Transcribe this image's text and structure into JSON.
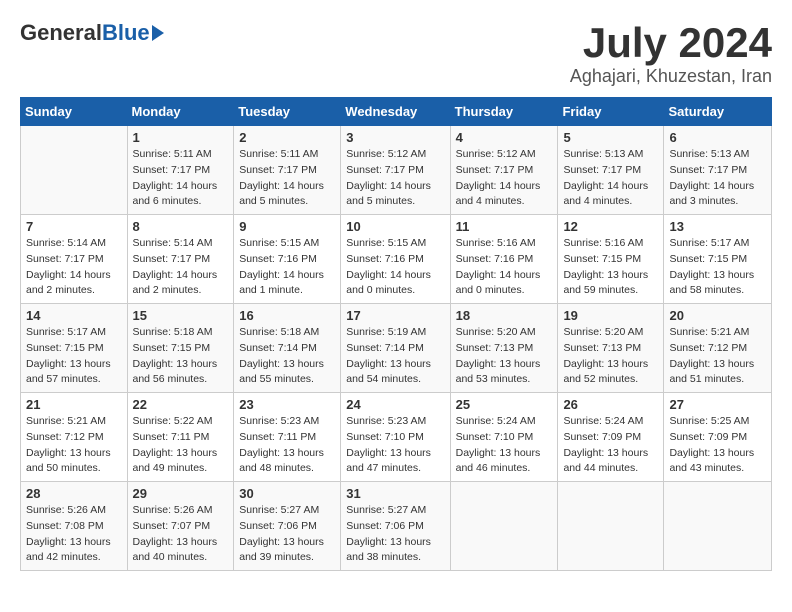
{
  "header": {
    "logo_general": "General",
    "logo_blue": "Blue",
    "month_title": "July 2024",
    "location": "Aghajari, Khuzestan, Iran"
  },
  "days_of_week": [
    "Sunday",
    "Monday",
    "Tuesday",
    "Wednesday",
    "Thursday",
    "Friday",
    "Saturday"
  ],
  "weeks": [
    [
      {
        "day": "",
        "sunrise": "",
        "sunset": "",
        "daylight": ""
      },
      {
        "day": "1",
        "sunrise": "Sunrise: 5:11 AM",
        "sunset": "Sunset: 7:17 PM",
        "daylight": "Daylight: 14 hours and 6 minutes."
      },
      {
        "day": "2",
        "sunrise": "Sunrise: 5:11 AM",
        "sunset": "Sunset: 7:17 PM",
        "daylight": "Daylight: 14 hours and 5 minutes."
      },
      {
        "day": "3",
        "sunrise": "Sunrise: 5:12 AM",
        "sunset": "Sunset: 7:17 PM",
        "daylight": "Daylight: 14 hours and 5 minutes."
      },
      {
        "day": "4",
        "sunrise": "Sunrise: 5:12 AM",
        "sunset": "Sunset: 7:17 PM",
        "daylight": "Daylight: 14 hours and 4 minutes."
      },
      {
        "day": "5",
        "sunrise": "Sunrise: 5:13 AM",
        "sunset": "Sunset: 7:17 PM",
        "daylight": "Daylight: 14 hours and 4 minutes."
      },
      {
        "day": "6",
        "sunrise": "Sunrise: 5:13 AM",
        "sunset": "Sunset: 7:17 PM",
        "daylight": "Daylight: 14 hours and 3 minutes."
      }
    ],
    [
      {
        "day": "7",
        "sunrise": "Sunrise: 5:14 AM",
        "sunset": "Sunset: 7:17 PM",
        "daylight": "Daylight: 14 hours and 2 minutes."
      },
      {
        "day": "8",
        "sunrise": "Sunrise: 5:14 AM",
        "sunset": "Sunset: 7:17 PM",
        "daylight": "Daylight: 14 hours and 2 minutes."
      },
      {
        "day": "9",
        "sunrise": "Sunrise: 5:15 AM",
        "sunset": "Sunset: 7:16 PM",
        "daylight": "Daylight: 14 hours and 1 minute."
      },
      {
        "day": "10",
        "sunrise": "Sunrise: 5:15 AM",
        "sunset": "Sunset: 7:16 PM",
        "daylight": "Daylight: 14 hours and 0 minutes."
      },
      {
        "day": "11",
        "sunrise": "Sunrise: 5:16 AM",
        "sunset": "Sunset: 7:16 PM",
        "daylight": "Daylight: 14 hours and 0 minutes."
      },
      {
        "day": "12",
        "sunrise": "Sunrise: 5:16 AM",
        "sunset": "Sunset: 7:15 PM",
        "daylight": "Daylight: 13 hours and 59 minutes."
      },
      {
        "day": "13",
        "sunrise": "Sunrise: 5:17 AM",
        "sunset": "Sunset: 7:15 PM",
        "daylight": "Daylight: 13 hours and 58 minutes."
      }
    ],
    [
      {
        "day": "14",
        "sunrise": "Sunrise: 5:17 AM",
        "sunset": "Sunset: 7:15 PM",
        "daylight": "Daylight: 13 hours and 57 minutes."
      },
      {
        "day": "15",
        "sunrise": "Sunrise: 5:18 AM",
        "sunset": "Sunset: 7:15 PM",
        "daylight": "Daylight: 13 hours and 56 minutes."
      },
      {
        "day": "16",
        "sunrise": "Sunrise: 5:18 AM",
        "sunset": "Sunset: 7:14 PM",
        "daylight": "Daylight: 13 hours and 55 minutes."
      },
      {
        "day": "17",
        "sunrise": "Sunrise: 5:19 AM",
        "sunset": "Sunset: 7:14 PM",
        "daylight": "Daylight: 13 hours and 54 minutes."
      },
      {
        "day": "18",
        "sunrise": "Sunrise: 5:20 AM",
        "sunset": "Sunset: 7:13 PM",
        "daylight": "Daylight: 13 hours and 53 minutes."
      },
      {
        "day": "19",
        "sunrise": "Sunrise: 5:20 AM",
        "sunset": "Sunset: 7:13 PM",
        "daylight": "Daylight: 13 hours and 52 minutes."
      },
      {
        "day": "20",
        "sunrise": "Sunrise: 5:21 AM",
        "sunset": "Sunset: 7:12 PM",
        "daylight": "Daylight: 13 hours and 51 minutes."
      }
    ],
    [
      {
        "day": "21",
        "sunrise": "Sunrise: 5:21 AM",
        "sunset": "Sunset: 7:12 PM",
        "daylight": "Daylight: 13 hours and 50 minutes."
      },
      {
        "day": "22",
        "sunrise": "Sunrise: 5:22 AM",
        "sunset": "Sunset: 7:11 PM",
        "daylight": "Daylight: 13 hours and 49 minutes."
      },
      {
        "day": "23",
        "sunrise": "Sunrise: 5:23 AM",
        "sunset": "Sunset: 7:11 PM",
        "daylight": "Daylight: 13 hours and 48 minutes."
      },
      {
        "day": "24",
        "sunrise": "Sunrise: 5:23 AM",
        "sunset": "Sunset: 7:10 PM",
        "daylight": "Daylight: 13 hours and 47 minutes."
      },
      {
        "day": "25",
        "sunrise": "Sunrise: 5:24 AM",
        "sunset": "Sunset: 7:10 PM",
        "daylight": "Daylight: 13 hours and 46 minutes."
      },
      {
        "day": "26",
        "sunrise": "Sunrise: 5:24 AM",
        "sunset": "Sunset: 7:09 PM",
        "daylight": "Daylight: 13 hours and 44 minutes."
      },
      {
        "day": "27",
        "sunrise": "Sunrise: 5:25 AM",
        "sunset": "Sunset: 7:09 PM",
        "daylight": "Daylight: 13 hours and 43 minutes."
      }
    ],
    [
      {
        "day": "28",
        "sunrise": "Sunrise: 5:26 AM",
        "sunset": "Sunset: 7:08 PM",
        "daylight": "Daylight: 13 hours and 42 minutes."
      },
      {
        "day": "29",
        "sunrise": "Sunrise: 5:26 AM",
        "sunset": "Sunset: 7:07 PM",
        "daylight": "Daylight: 13 hours and 40 minutes."
      },
      {
        "day": "30",
        "sunrise": "Sunrise: 5:27 AM",
        "sunset": "Sunset: 7:06 PM",
        "daylight": "Daylight: 13 hours and 39 minutes."
      },
      {
        "day": "31",
        "sunrise": "Sunrise: 5:27 AM",
        "sunset": "Sunset: 7:06 PM",
        "daylight": "Daylight: 13 hours and 38 minutes."
      },
      {
        "day": "",
        "sunrise": "",
        "sunset": "",
        "daylight": ""
      },
      {
        "day": "",
        "sunrise": "",
        "sunset": "",
        "daylight": ""
      },
      {
        "day": "",
        "sunrise": "",
        "sunset": "",
        "daylight": ""
      }
    ]
  ]
}
